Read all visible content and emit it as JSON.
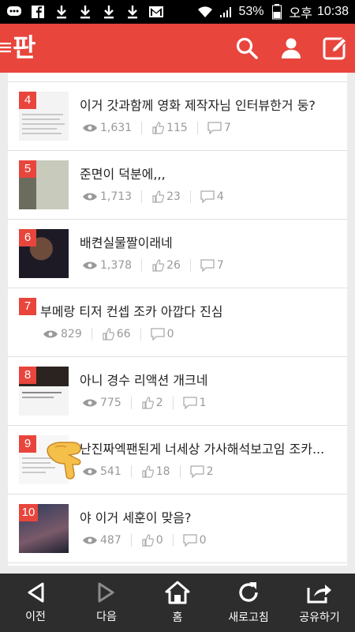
{
  "status_bar": {
    "battery": "53%",
    "ampm": "오후",
    "time": "10:38",
    "icons": [
      "chat-icon",
      "facebook-icon",
      "download-icon",
      "download-icon",
      "download-icon",
      "download-icon",
      "gmail-icon",
      "wifi-icon",
      "signal-icon",
      "battery-icon"
    ]
  },
  "header": {
    "logo": "판",
    "icons": [
      "search-icon",
      "user-icon",
      "compose-icon"
    ],
    "brand_color": "#e8453c"
  },
  "posts": [
    {
      "rank": "4",
      "title": "이거 갓과함께 영화 제작자님 인터뷰한거 둥?",
      "views": "1,631",
      "likes": "115",
      "comments": "7"
    },
    {
      "rank": "5",
      "title": "준면이 덕분에,,,",
      "views": "1,713",
      "likes": "23",
      "comments": "4"
    },
    {
      "rank": "6",
      "title": "배켠실물짤이래네",
      "views": "1,378",
      "likes": "26",
      "comments": "7"
    },
    {
      "rank": "7",
      "title": "부메랑 티저 컨셉 조카 아깝다 진심",
      "views": "829",
      "likes": "66",
      "comments": "0"
    },
    {
      "rank": "8",
      "title": "아니 경수 리액션 개크네",
      "views": "775",
      "likes": "2",
      "comments": "1"
    },
    {
      "rank": "9",
      "title": "난진짜엑팬된게 너세상 가사해석보고임 조카...",
      "views": "541",
      "likes": "18",
      "comments": "2"
    },
    {
      "rank": "10",
      "title": "야 이거 세훈이 맞음?",
      "views": "487",
      "likes": "0",
      "comments": "0"
    }
  ],
  "nav": {
    "prev": "이전",
    "next": "다음",
    "home": "홈",
    "refresh": "새로고침",
    "share": "공유하기"
  }
}
